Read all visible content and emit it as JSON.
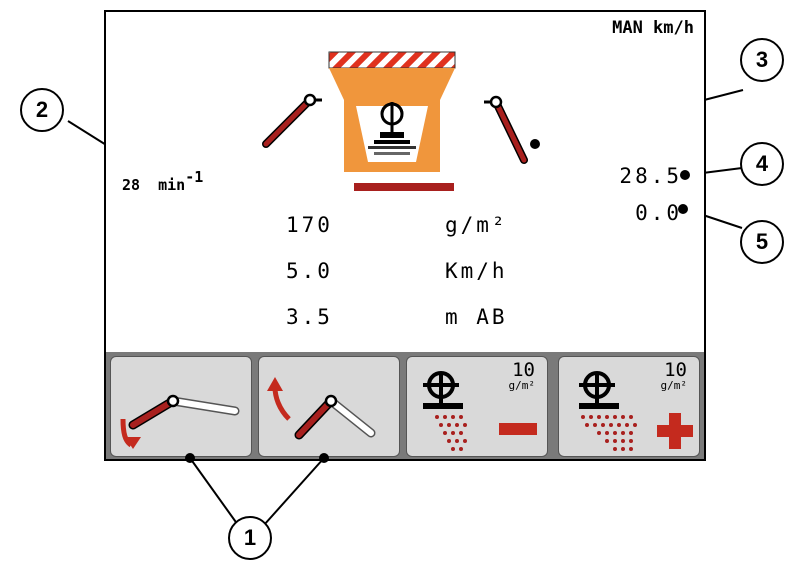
{
  "header": {
    "mode": "MAN km/h"
  },
  "spreader": {
    "disc_speed_value": "28",
    "disc_speed_unit": "min",
    "disc_speed_exp": "-1",
    "right_value_top": "28.5",
    "right_value_bottom": "0.0"
  },
  "readouts": [
    {
      "value": "170",
      "unit": "g/m²"
    },
    {
      "value": "5.0",
      "unit": "Km/h"
    },
    {
      "value": "3.5",
      "unit": "m AB"
    }
  ],
  "softkeys": {
    "key3": {
      "step": "10",
      "unit": "g/m²"
    },
    "key4": {
      "step": "10",
      "unit": "g/m²"
    }
  },
  "callouts": [
    "1",
    "2",
    "3",
    "4",
    "5"
  ],
  "colors": {
    "orange": "#f0963c",
    "dark_red": "#a8201e",
    "stripe_red": "#e0311e",
    "key_bg": "#d9d9d9"
  }
}
